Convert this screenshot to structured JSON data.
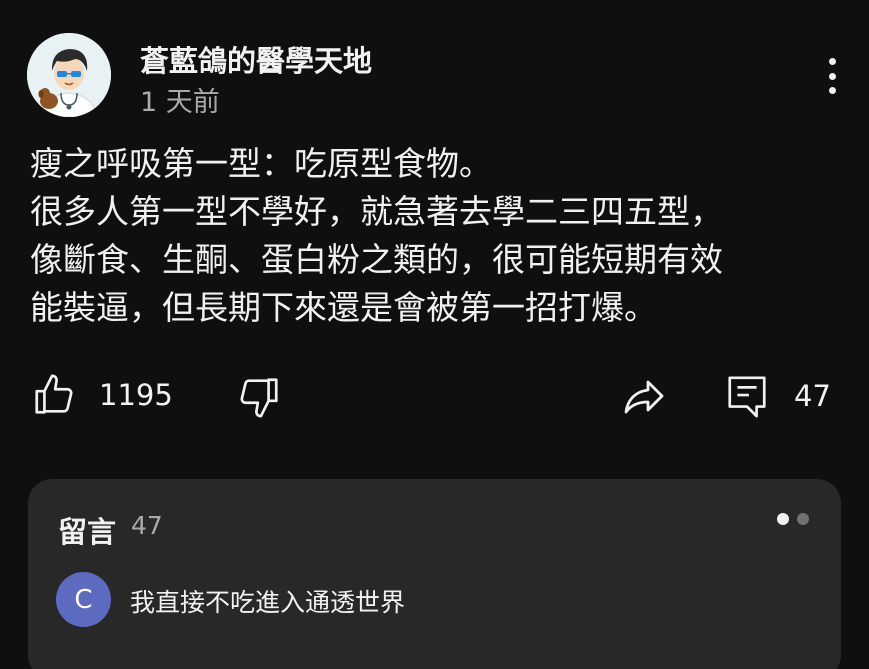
{
  "post": {
    "channel_name": "蒼藍鴿的醫學天地",
    "timestamp": "1 天前",
    "text_lines": [
      "瘦之呼吸第一型：吃原型食物。",
      "很多人第一型不學好，就急著去學二三四五型，",
      "像斷食、生酮、蛋白粉之類的，很可能短期有效",
      "能裝逼，但長期下來還是會被第一招打爆。"
    ]
  },
  "actions": {
    "like_icon": "thumb-up-icon",
    "like_count": "1195",
    "dislike_icon": "thumb-down-icon",
    "share_icon": "share-icon",
    "comment_icon": "comment-icon",
    "comment_count": "47"
  },
  "comments": {
    "title": "留言",
    "count": "47",
    "pager": {
      "pages": 2,
      "active": 0
    },
    "top_comment": {
      "avatar_letter": "C",
      "avatar_color": "#5c6bc0",
      "text": "我直接不吃進入通透世界"
    }
  },
  "colors": {
    "background": "#0f0f0f",
    "panel": "#282828",
    "primary_text": "#f1f1f1",
    "secondary_text": "#aaaaaa"
  }
}
